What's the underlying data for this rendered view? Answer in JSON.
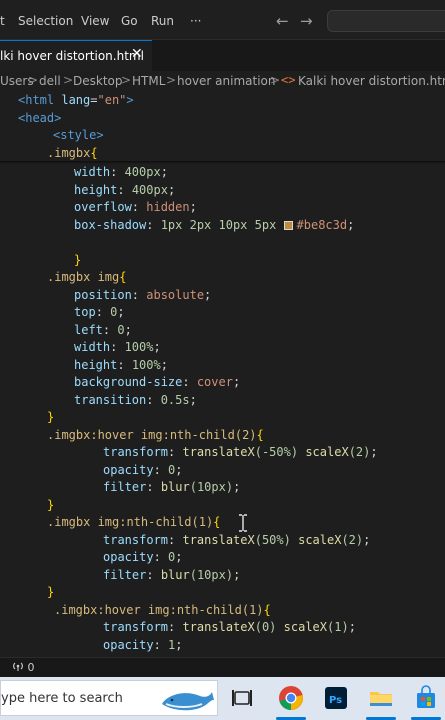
{
  "menu": {
    "items": [
      "t",
      "Selection",
      "View",
      "Go",
      "Run",
      "···"
    ],
    "back_arrow": "←",
    "forward_arrow": "→"
  },
  "tab": {
    "label": "lki hover distortion.html",
    "close": "✕"
  },
  "breadcrumb": {
    "items": [
      "Users",
      "dell",
      "Desktop",
      "HTML",
      "hover animation",
      "Kalki hover distortion.html"
    ],
    "separator": ">",
    "html_icon": "<>"
  },
  "code": {
    "sticky": [
      [
        "<html ",
        "lang",
        "=",
        "\"en\"",
        ">"
      ],
      [
        "<head>"
      ],
      [
        "<style>"
      ],
      [
        ".imgbx",
        "{"
      ]
    ],
    "lines": [
      [
        "width",
        ": ",
        "400px",
        ";"
      ],
      [
        "height",
        ": ",
        "400px",
        ";"
      ],
      [
        "overflow",
        ": ",
        "hidden",
        ";"
      ],
      [
        "box-shadow",
        ": ",
        "1px 2px 10px 5px ",
        "#be8c3d",
        ";"
      ],
      [
        ""
      ],
      [
        "}"
      ],
      [
        ".imgbx img",
        "{"
      ],
      [
        "position",
        ": ",
        "absolute",
        ";"
      ],
      [
        "top",
        ": ",
        "0",
        ";"
      ],
      [
        "left",
        ": ",
        "0",
        ";"
      ],
      [
        "width",
        ": ",
        "100%",
        ";"
      ],
      [
        "height",
        ": ",
        "100%",
        ";"
      ],
      [
        "background-size",
        ": ",
        "cover",
        ";"
      ],
      [
        "transition",
        ": ",
        "0.5s",
        ";"
      ],
      [
        "}"
      ],
      [
        ".imgbx:hover img:nth-child(2)",
        "{"
      ],
      [
        "transform",
        ": ",
        "translateX",
        "(-50%)",
        " ",
        "scaleX",
        "(2)",
        ";"
      ],
      [
        "opacity",
        ": ",
        "0",
        ";"
      ],
      [
        "filter",
        ": ",
        "blur",
        "(10px)",
        ";"
      ],
      [
        "}"
      ],
      [
        ".imgbx img:nth-child(1)",
        "{"
      ],
      [
        "transform",
        ": ",
        "translateX",
        "(50%)",
        " ",
        "scaleX",
        "(2)",
        ";"
      ],
      [
        "opacity",
        ": ",
        "0",
        ";"
      ],
      [
        "filter",
        ": ",
        "blur",
        "(10px)",
        ";"
      ],
      [
        "}"
      ],
      [
        ".imgbx:hover img:nth-child(1)",
        "{"
      ],
      [
        "transform",
        ": ",
        "translateX",
        "(0)",
        " ",
        "scaleX",
        "(1)",
        ";"
      ],
      [
        "opacity",
        ": ",
        "1",
        ";"
      ]
    ]
  },
  "status": {
    "ports": "0"
  },
  "taskbar": {
    "search_placeholder": "ype here to search"
  },
  "colors": {
    "accent": "#0078d4",
    "swatch": "#be8c3d"
  },
  "icons": [
    "back-arrow-icon",
    "forward-arrow-icon",
    "close-icon",
    "html-file-icon",
    "broadcast-icon",
    "whale-icon",
    "task-view-icon",
    "chrome-icon",
    "photoshop-icon",
    "file-explorer-icon",
    "store-icon"
  ]
}
